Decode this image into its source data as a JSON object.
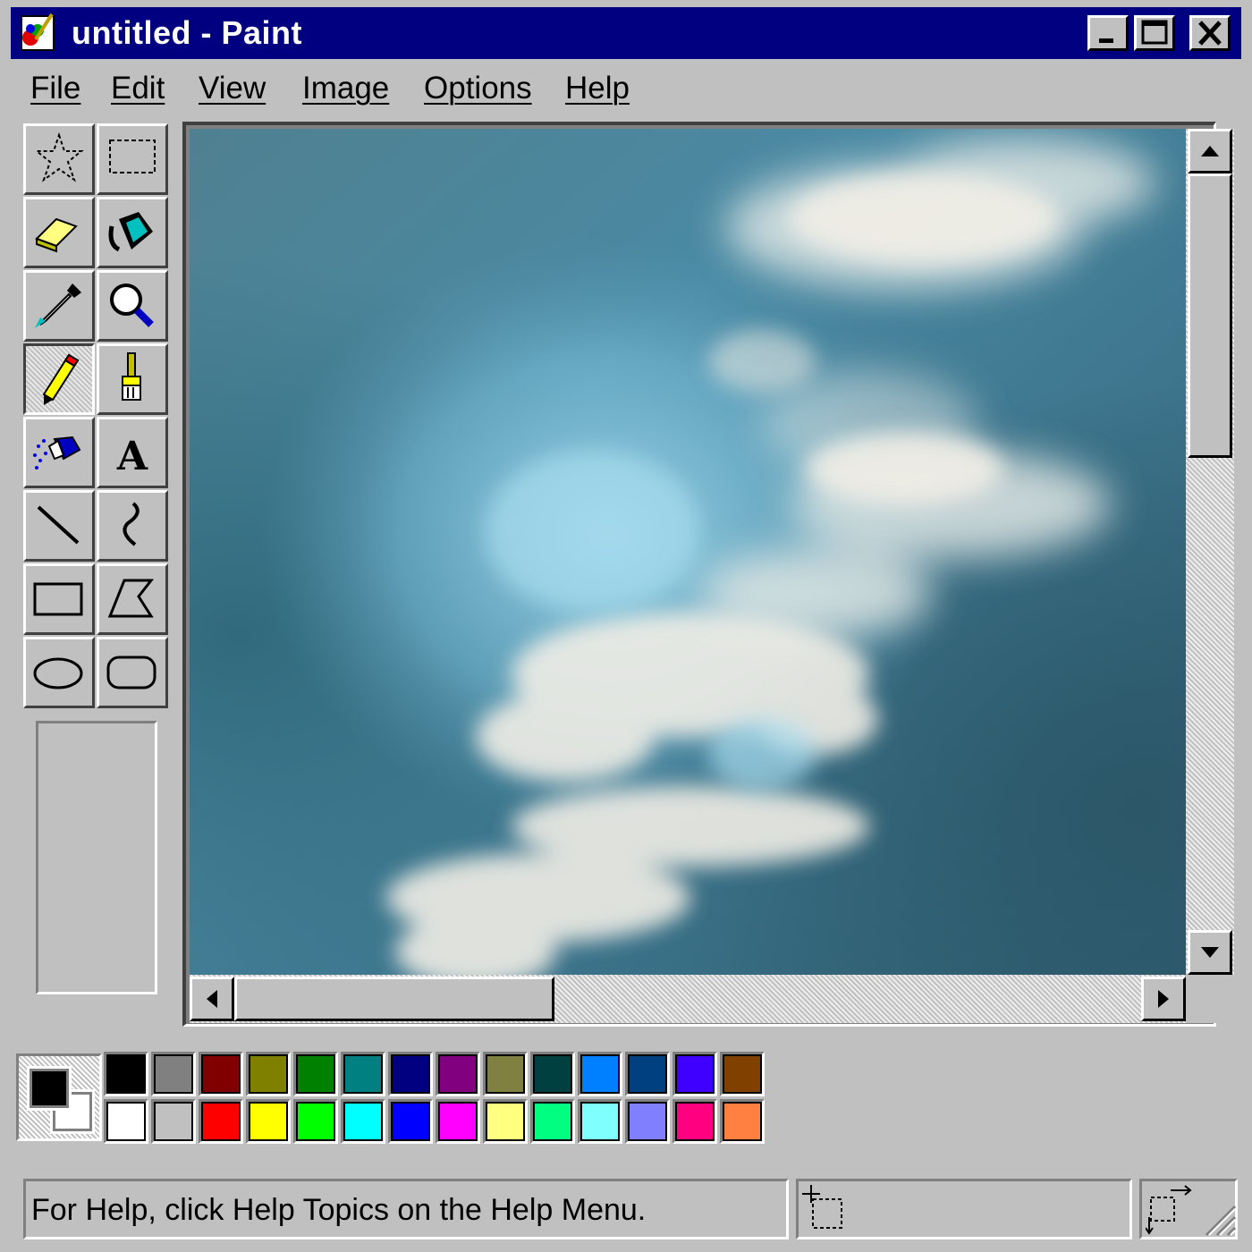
{
  "window": {
    "title": "untitled - Paint",
    "app_icon": "paint-app-icon",
    "controls": [
      "minimize-icon",
      "maximize-icon",
      "close-icon"
    ],
    "title_bar_color": "#000080",
    "face_color": "#c0c0c0"
  },
  "menu": {
    "items": [
      {
        "label": "File"
      },
      {
        "label": "Edit"
      },
      {
        "label": "View"
      },
      {
        "label": "Image"
      },
      {
        "label": "Options"
      },
      {
        "label": "Help"
      }
    ]
  },
  "toolbox": {
    "tools": [
      {
        "name": "free-form-select",
        "icon": "star-select-icon",
        "active": false
      },
      {
        "name": "select",
        "icon": "rect-select-icon",
        "active": false
      },
      {
        "name": "eraser",
        "icon": "eraser-icon",
        "active": false
      },
      {
        "name": "fill-with-color",
        "icon": "paint-bucket-icon",
        "active": false
      },
      {
        "name": "pick-color",
        "icon": "eyedropper-icon",
        "active": false
      },
      {
        "name": "magnifier",
        "icon": "magnifier-icon",
        "active": false
      },
      {
        "name": "pencil",
        "icon": "pencil-icon",
        "active": true
      },
      {
        "name": "brush",
        "icon": "brush-icon",
        "active": false
      },
      {
        "name": "airbrush",
        "icon": "airbrush-icon",
        "active": false
      },
      {
        "name": "text",
        "icon": "text-tool-icon",
        "active": false
      },
      {
        "name": "line",
        "icon": "line-icon",
        "active": false
      },
      {
        "name": "curve",
        "icon": "curve-icon",
        "active": false
      },
      {
        "name": "rectangle",
        "icon": "rectangle-icon",
        "active": false
      },
      {
        "name": "polygon",
        "icon": "polygon-icon",
        "active": false
      },
      {
        "name": "ellipse",
        "icon": "ellipse-icon",
        "active": false
      },
      {
        "name": "rounded-rectangle",
        "icon": "rounded-rectangle-icon",
        "active": false
      }
    ],
    "text_tool_glyph": "A"
  },
  "canvas": {
    "content": "cloudy-sky-photo"
  },
  "scroll": {
    "vertical_thumb_fraction": 0.38,
    "horizontal_thumb_fraction": 0.36
  },
  "colors": {
    "foreground": "#000000",
    "background": "#ffffff",
    "palette": [
      "#000000",
      "#808080",
      "#800000",
      "#808000",
      "#008000",
      "#008080",
      "#000080",
      "#800080",
      "#808040",
      "#004040",
      "#0080ff",
      "#004080",
      "#4000ff",
      "#804000",
      "#ffffff",
      "#c0c0c0",
      "#ff0000",
      "#ffff00",
      "#00ff00",
      "#00ffff",
      "#0000ff",
      "#ff00ff",
      "#ffff80",
      "#00ff80",
      "#80ffff",
      "#8080ff",
      "#ff0080",
      "#ff8040"
    ]
  },
  "status": {
    "text": "For Help, click Help Topics on the Help Menu.",
    "position_icon": "cursor-position-icon",
    "size_icon": "selection-size-icon"
  }
}
